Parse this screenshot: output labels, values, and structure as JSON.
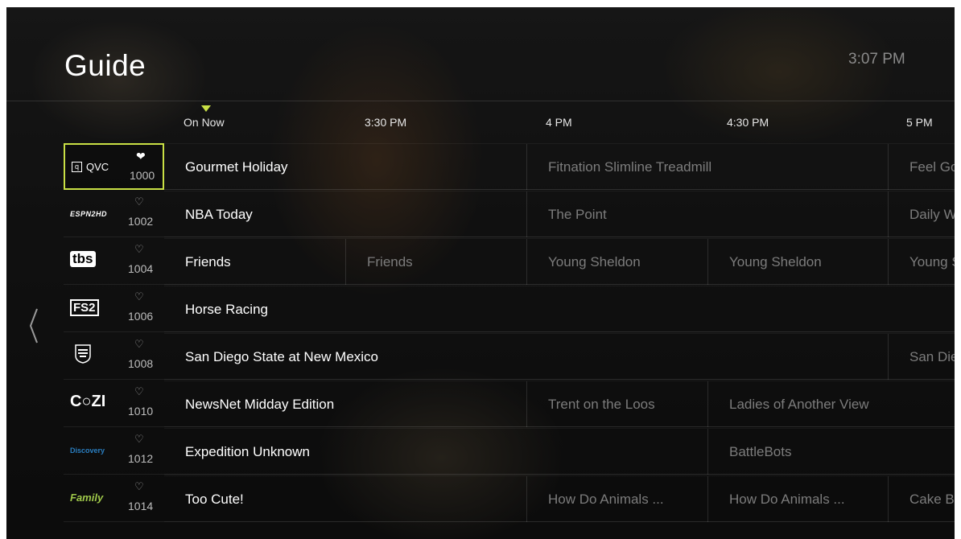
{
  "header": {
    "title": "Guide",
    "clock": "3:07 PM"
  },
  "timeline": {
    "labels": [
      "On Now",
      "3:30 PM",
      "4 PM",
      "4:30 PM",
      "5 PM"
    ]
  },
  "channels": [
    {
      "logo": "QVC",
      "logo_icon": "qvc-logo",
      "number": "1000",
      "favorite": true
    },
    {
      "logo": "ESPN2HD",
      "logo_icon": "espn2hd-logo",
      "number": "1002",
      "favorite": false
    },
    {
      "logo": "tbs",
      "logo_icon": "tbs-logo",
      "number": "1004",
      "favorite": false
    },
    {
      "logo": "FS2",
      "logo_icon": "fs2-logo",
      "number": "1006",
      "favorite": false
    },
    {
      "logo": "STADIUM COLLEGE SPORTS",
      "logo_icon": "stadium-college-sports-logo",
      "number": "1008",
      "favorite": false
    },
    {
      "logo": "COZI",
      "logo_icon": "cozi-tv-logo",
      "number": "1010",
      "favorite": false
    },
    {
      "logo": "Discovery",
      "logo_icon": "discovery-logo",
      "number": "1012",
      "favorite": false
    },
    {
      "logo": "Family",
      "logo_icon": "discovery-family-logo",
      "number": "1014",
      "favorite": false
    }
  ],
  "programs": [
    [
      {
        "title": "Gourmet Holiday",
        "state": "now"
      },
      {
        "title": "Fitnation Slimline Treadmill",
        "state": "later"
      },
      {
        "title": "Feel Go",
        "state": "later"
      }
    ],
    [
      {
        "title": "NBA Today",
        "state": "now"
      },
      {
        "title": "The Point",
        "state": "later"
      },
      {
        "title": "Daily W",
        "state": "later"
      }
    ],
    [
      {
        "title": "Friends",
        "state": "now"
      },
      {
        "title": "Friends",
        "state": "later"
      },
      {
        "title": "Young Sheldon",
        "state": "later"
      },
      {
        "title": "Young Sheldon",
        "state": "later"
      },
      {
        "title": "Young S",
        "state": "later"
      }
    ],
    [
      {
        "title": "Horse Racing",
        "state": "now"
      }
    ],
    [
      {
        "title": "San Diego State at New Mexico",
        "state": "now"
      },
      {
        "title": "San Die",
        "state": "later"
      }
    ],
    [
      {
        "title": "NewsNet Midday Edition",
        "state": "now"
      },
      {
        "title": "Trent on the Loos",
        "state": "later"
      },
      {
        "title": "Ladies of Another View",
        "state": "later"
      }
    ],
    [
      {
        "title": "Expedition Unknown",
        "state": "now"
      },
      {
        "title": "BattleBots",
        "state": "later"
      }
    ],
    [
      {
        "title": "Too Cute!",
        "state": "now"
      },
      {
        "title": "How Do Animals ...",
        "state": "later"
      },
      {
        "title": "How Do Animals ...",
        "state": "later"
      },
      {
        "title": "Cake Bo",
        "state": "later"
      }
    ]
  ],
  "icons": {
    "favorite_filled": "heart-filled-icon",
    "favorite_outline": "heart-outline-icon",
    "prev": "chevron-left-icon",
    "now_marker": "now-indicator-icon"
  },
  "colors": {
    "accent": "#c9e045",
    "text_primary": "#ffffff",
    "text_dim": "#7c7c7c"
  }
}
